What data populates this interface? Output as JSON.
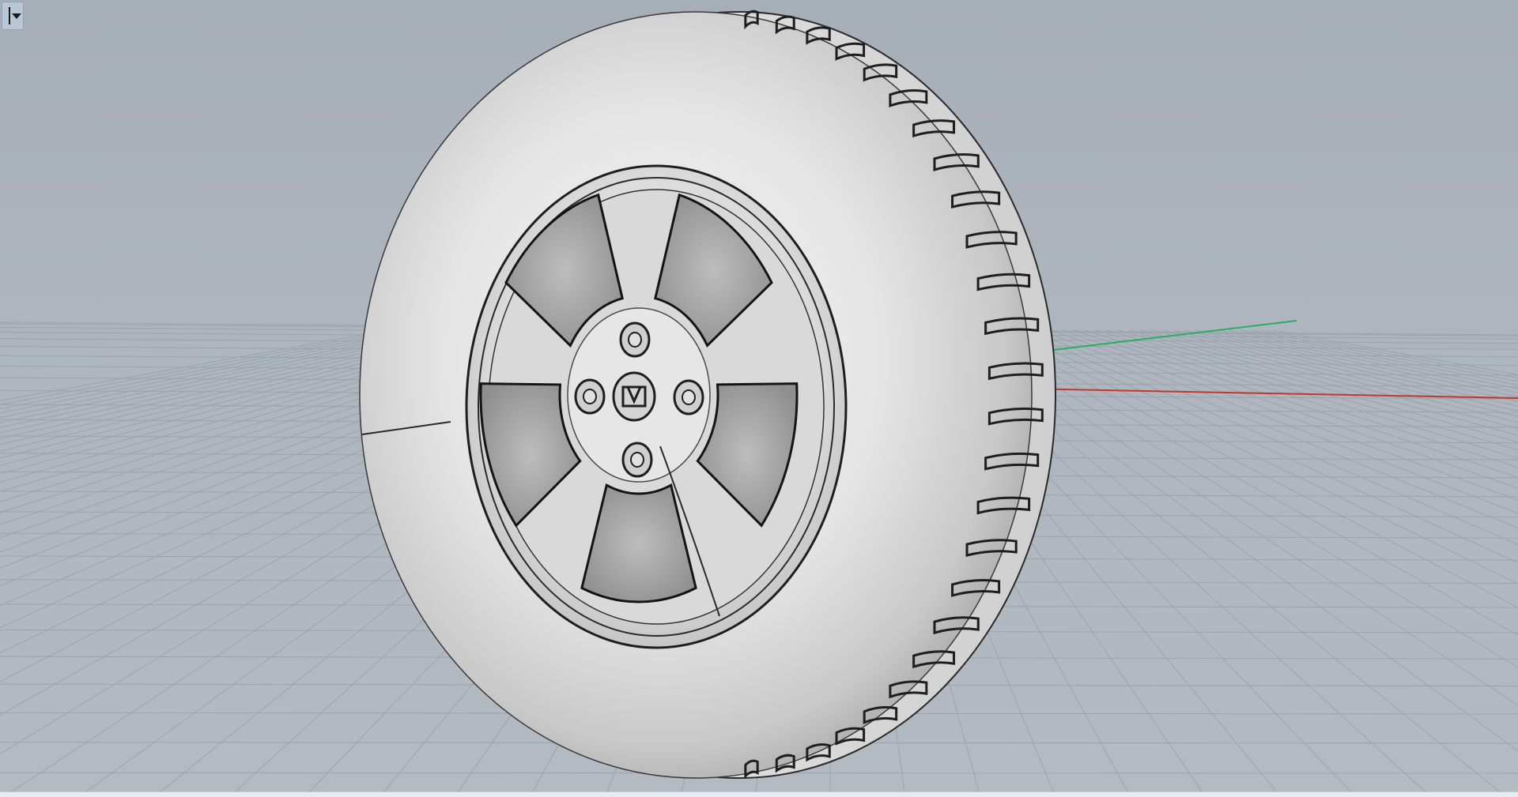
{
  "viewport": {
    "name": "",
    "menu_icon": "viewport-menu-caret-icon",
    "background_color": "#aab2bc",
    "grid_color": "#9ea6b0",
    "axes": {
      "x_color": "#c0392b",
      "y_color": "#27ae60"
    },
    "object": {
      "type": "wheel-with-tire",
      "spokes": 5,
      "lug_nuts": 4,
      "center_cap_logo_icon": "h-logo-icon"
    }
  }
}
